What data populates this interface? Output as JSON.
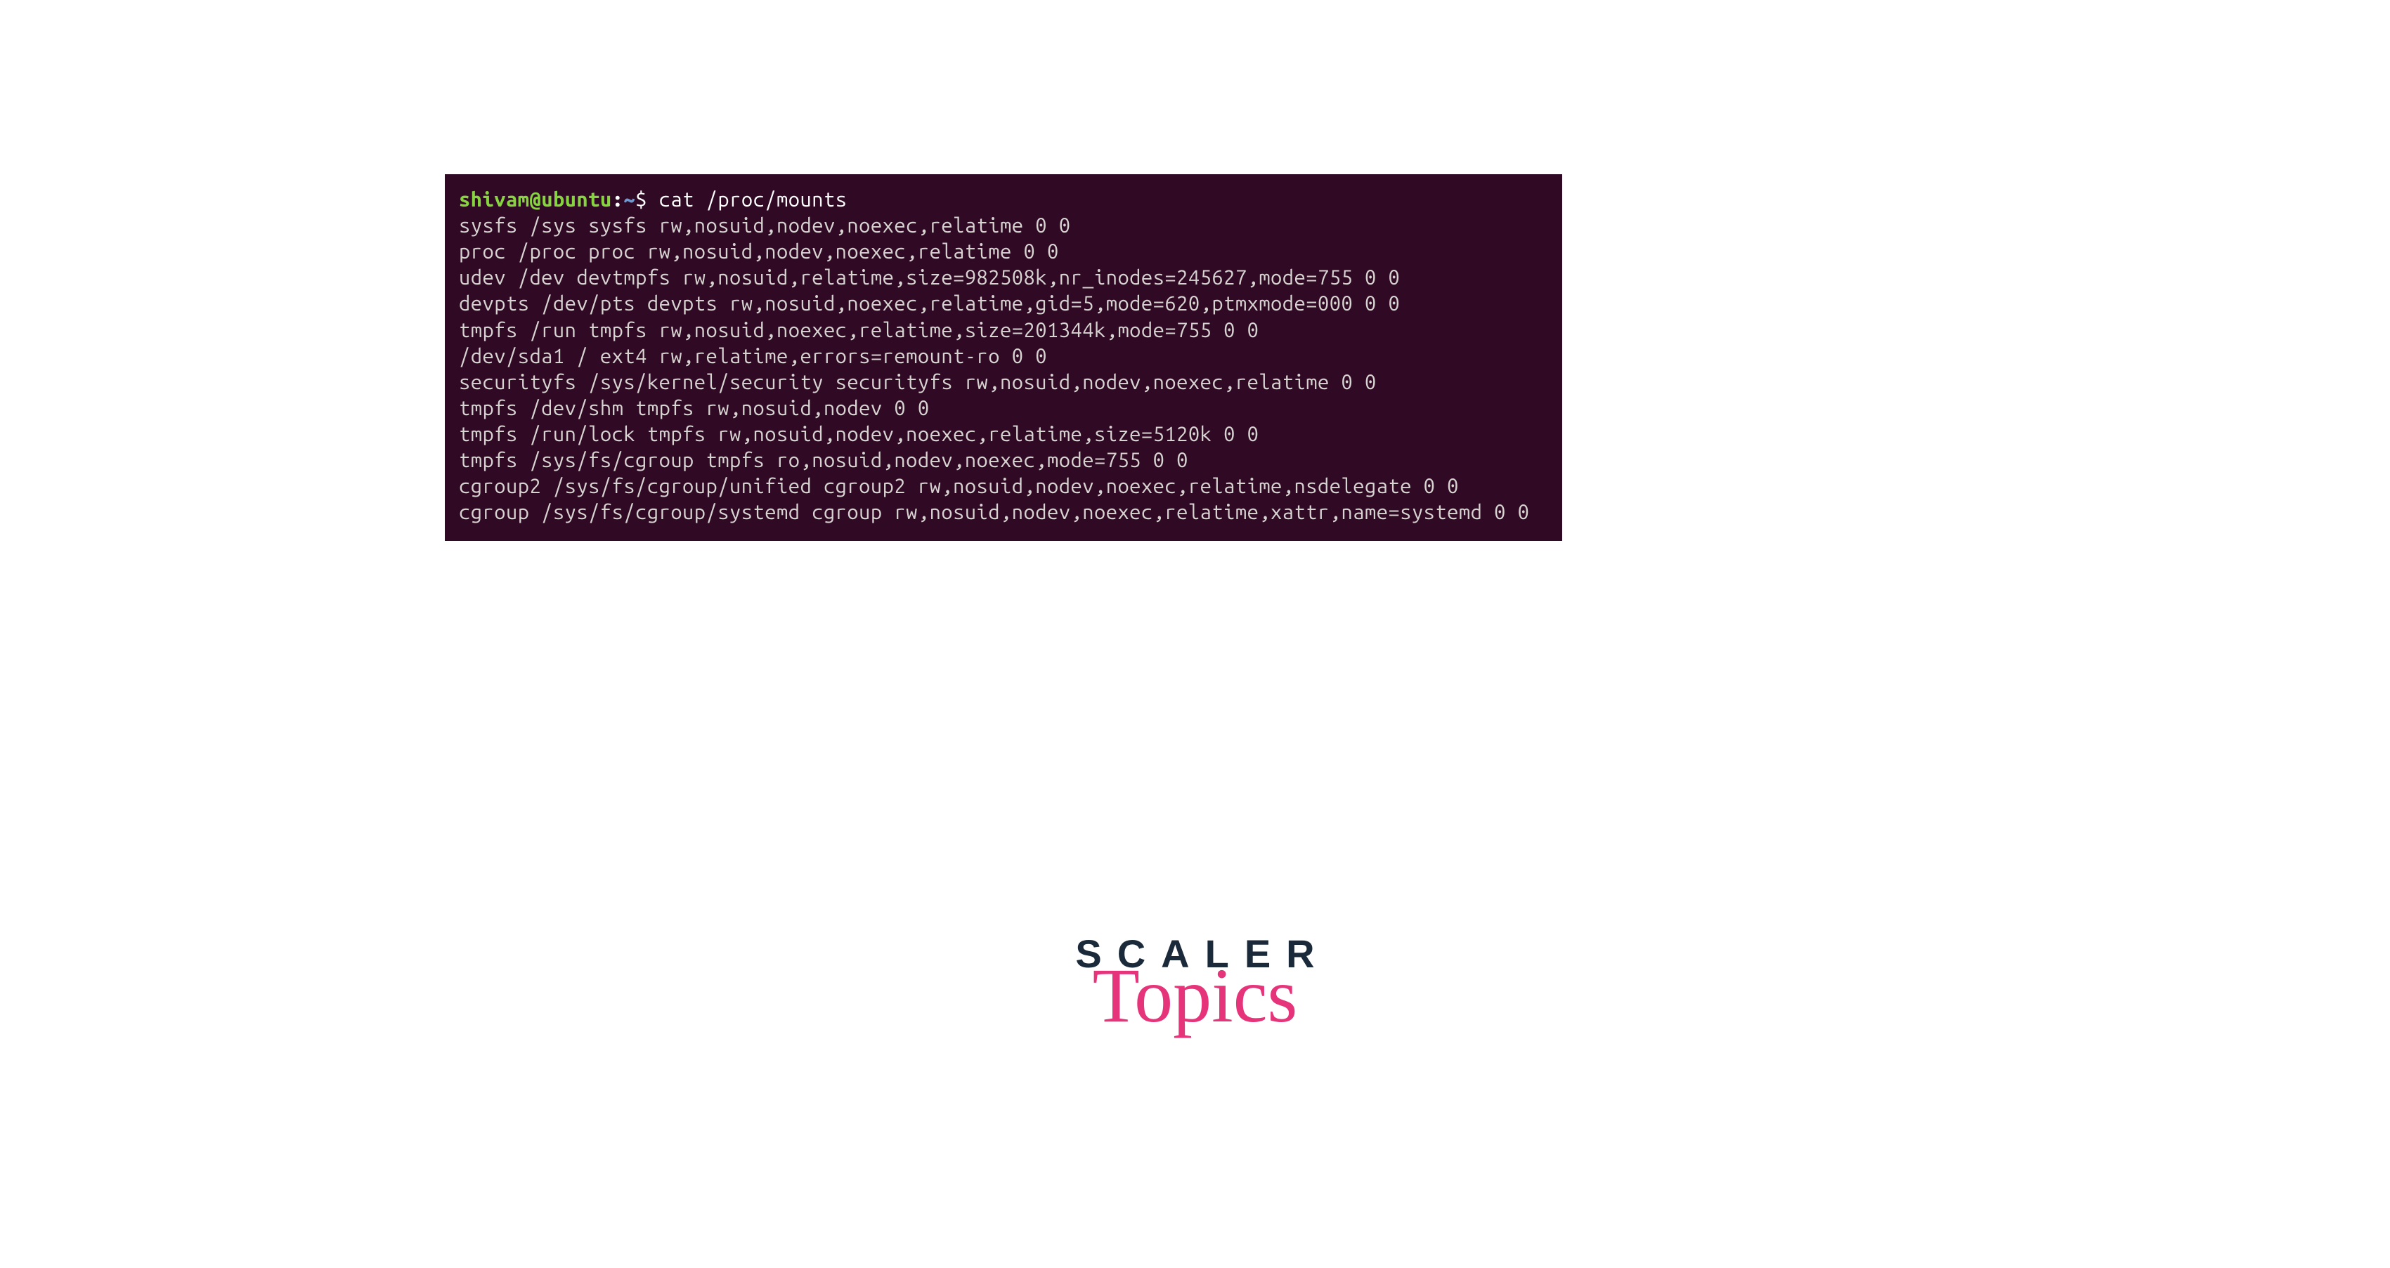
{
  "terminal": {
    "prompt": {
      "user": "shivam",
      "at": "@",
      "host": "ubuntu",
      "colon": ":",
      "path": "~",
      "symbol": "$"
    },
    "command": "cat /proc/mounts",
    "output": [
      "sysfs /sys sysfs rw,nosuid,nodev,noexec,relatime 0 0",
      "proc /proc proc rw,nosuid,nodev,noexec,relatime 0 0",
      "udev /dev devtmpfs rw,nosuid,relatime,size=982508k,nr_inodes=245627,mode=755 0 0",
      "devpts /dev/pts devpts rw,nosuid,noexec,relatime,gid=5,mode=620,ptmxmode=000 0 0",
      "tmpfs /run tmpfs rw,nosuid,noexec,relatime,size=201344k,mode=755 0 0",
      "/dev/sda1 / ext4 rw,relatime,errors=remount-ro 0 0",
      "securityfs /sys/kernel/security securityfs rw,nosuid,nodev,noexec,relatime 0 0",
      "tmpfs /dev/shm tmpfs rw,nosuid,nodev 0 0",
      "tmpfs /run/lock tmpfs rw,nosuid,nodev,noexec,relatime,size=5120k 0 0",
      "tmpfs /sys/fs/cgroup tmpfs ro,nosuid,nodev,noexec,mode=755 0 0",
      "cgroup2 /sys/fs/cgroup/unified cgroup2 rw,nosuid,nodev,noexec,relatime,nsdelegate 0 0",
      "cgroup /sys/fs/cgroup/systemd cgroup rw,nosuid,nodev,noexec,relatime,xattr,name=systemd 0 0"
    ]
  },
  "logo": {
    "line1": "SCALER",
    "line2": "Topics"
  }
}
